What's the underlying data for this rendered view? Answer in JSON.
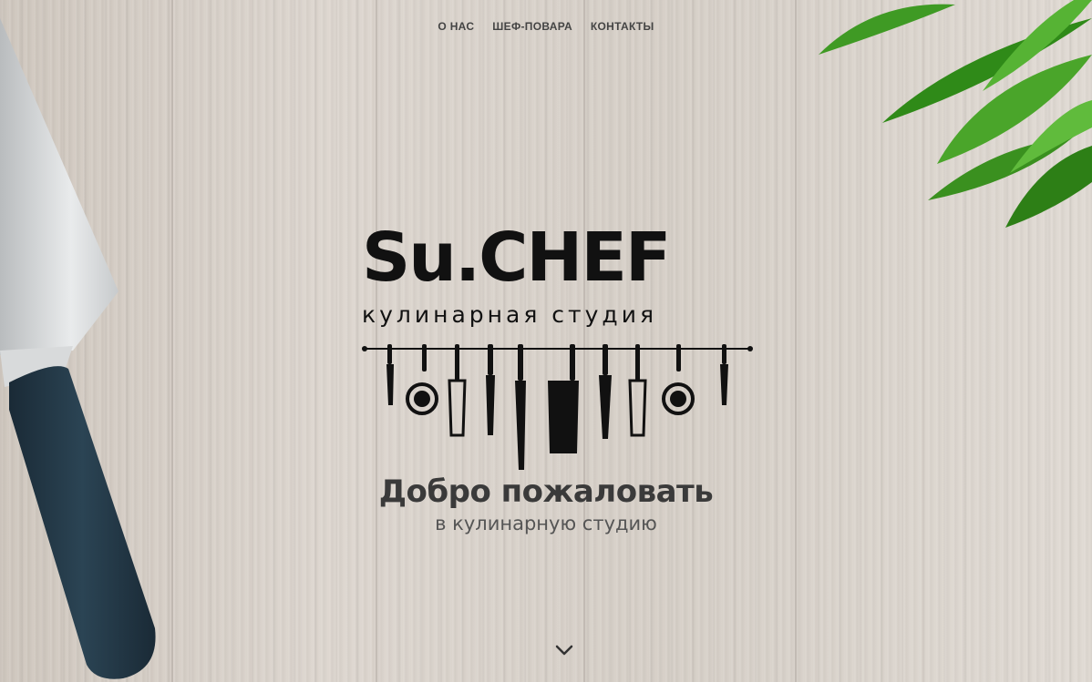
{
  "nav": {
    "items": [
      {
        "label": "О НАС"
      },
      {
        "label": "ШЕФ-ПОВАРА"
      },
      {
        "label": "КОНТАКТЫ"
      }
    ]
  },
  "logo": {
    "name": "Su.CHEF",
    "tagline": "кулинарная студия"
  },
  "hero": {
    "title": "Добро пожаловать",
    "subtitle": "в кулинарную студию"
  },
  "icons": {
    "scroll": "chevron-down-icon"
  },
  "colors": {
    "text": "#3a3a3a",
    "knife_handle": "#1f3442",
    "leaf": "#3a8a1e"
  }
}
